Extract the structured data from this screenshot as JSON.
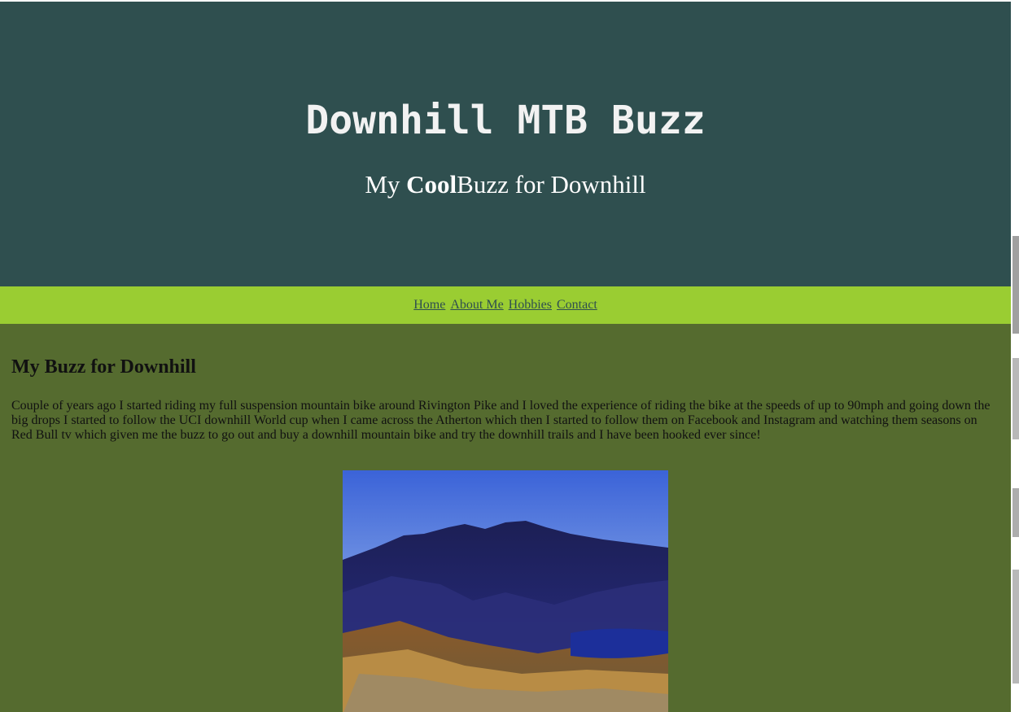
{
  "header": {
    "title": "Downhill MTB Buzz",
    "tagline_prefix": "My ",
    "tagline_bold": "Cool",
    "tagline_suffix": "Buzz for Downhill"
  },
  "nav": {
    "items": [
      "Home",
      "About Me",
      "Hobbies",
      "Contact"
    ]
  },
  "main": {
    "heading": "My Buzz for Downhill",
    "paragraph": "Couple of years ago I started riding my full suspension mountain bike around Rivington Pike and I loved the experience of riding the bike at the speeds of up to 90mph and going down the big drops I started to follow the UCI downhill World cup when I came across the Atherton which then I started to follow them on Facebook and Instagram and watching them seasons on Red Bull tv which given me the buzz to go out and buy a downhill mountain bike and try the downhill trails and I have been hooked ever since!",
    "image": "mountain-landscape-photo"
  },
  "colors": {
    "header_bg": "#2f4f4f",
    "nav_bg": "#9acd32",
    "content_bg": "#556b2f",
    "link": "#2f4f4f"
  }
}
